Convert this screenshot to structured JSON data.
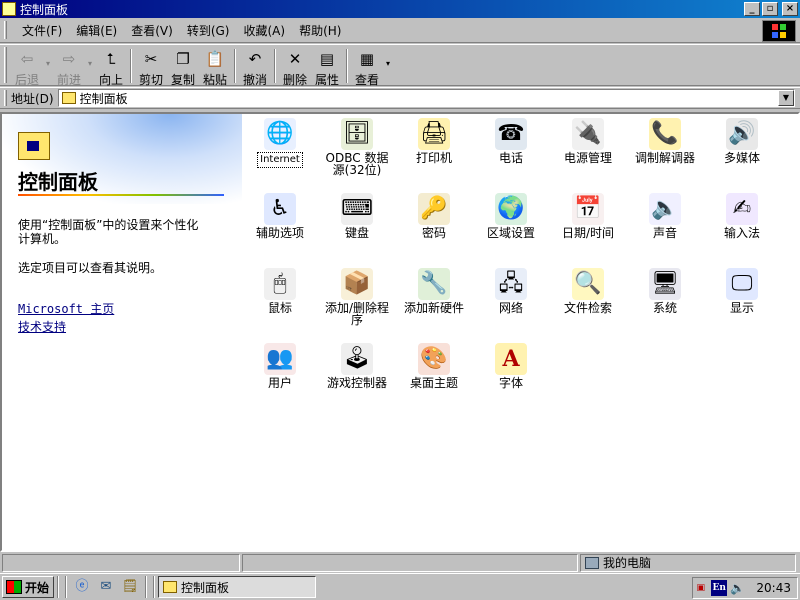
{
  "window": {
    "title": "控制面板",
    "min_symbol": "_",
    "max_symbol": "▫",
    "close_symbol": "×"
  },
  "menu": [
    "文件(F)",
    "编辑(E)",
    "查看(V)",
    "转到(G)",
    "收藏(A)",
    "帮助(H)"
  ],
  "toolbar": {
    "back": "后退",
    "forward": "前进",
    "up": "向上",
    "cut": "剪切",
    "copy": "复制",
    "paste": "粘贴",
    "undo": "撤消",
    "delete": "删除",
    "properties": "属性",
    "views": "查看",
    "dropdown_symbol": "▾"
  },
  "address": {
    "label": "地址(D)",
    "value": "控制面板",
    "drop_symbol": "▼"
  },
  "left_pane": {
    "title": "控制面板",
    "description": "使用“控制面板”中的设置来个性化计算机。",
    "hint": "选定项目可以查看其说明。",
    "link_home": "Microsoft 主页",
    "link_support": "技术支持"
  },
  "items": [
    {
      "label": "Internet",
      "icon": "internet-icon",
      "glyph": "🌐",
      "color": "#e8f0ff"
    },
    {
      "label": "ODBC 数据源(32位)",
      "icon": "database-icon",
      "glyph": "🗄",
      "color": "#e8f0d8"
    },
    {
      "label": "打印机",
      "icon": "printer-folder-icon",
      "glyph": "🖨",
      "color": "#fff2b0"
    },
    {
      "label": "电话",
      "icon": "phone-icon",
      "glyph": "☎",
      "color": "#e0e8f0"
    },
    {
      "label": "电源管理",
      "icon": "power-icon",
      "glyph": "🔌",
      "color": "#f0f0f0"
    },
    {
      "label": "调制解调器",
      "icon": "modem-icon",
      "glyph": "📞",
      "color": "#fff2b0"
    },
    {
      "label": "多媒体",
      "icon": "multimedia-icon",
      "glyph": "🔊",
      "color": "#e8e8e8"
    },
    {
      "label": "辅助选项",
      "icon": "accessibility-icon",
      "glyph": "♿",
      "color": "#dfe8ff"
    },
    {
      "label": "键盘",
      "icon": "keyboard-icon",
      "glyph": "⌨",
      "color": "#eeeeee"
    },
    {
      "label": "密码",
      "icon": "password-key-icon",
      "glyph": "🔑",
      "color": "#f4ecd0"
    },
    {
      "label": "区域设置",
      "icon": "globe-icon",
      "glyph": "🌍",
      "color": "#d8f0e0"
    },
    {
      "label": "日期/时间",
      "icon": "date-time-icon",
      "glyph": "📅",
      "color": "#f8f0f0"
    },
    {
      "label": "声音",
      "icon": "sound-icon",
      "glyph": "🔈",
      "color": "#f0f0ff"
    },
    {
      "label": "输入法",
      "icon": "input-method-icon",
      "glyph": "✍",
      "color": "#f0e8ff"
    },
    {
      "label": "鼠标",
      "icon": "mouse-icon",
      "glyph": "🖱",
      "color": "#f0f0f0"
    },
    {
      "label": "添加/删除程序",
      "icon": "add-remove-programs-icon",
      "glyph": "📦",
      "color": "#f8f0d8"
    },
    {
      "label": "添加新硬件",
      "icon": "add-hardware-icon",
      "glyph": "🔧",
      "color": "#e0f0d8"
    },
    {
      "label": "网络",
      "icon": "network-icon",
      "glyph": "🖧",
      "color": "#e8eef8"
    },
    {
      "label": "文件检索",
      "icon": "find-fast-icon",
      "glyph": "🔍",
      "color": "#fff8c0"
    },
    {
      "label": "系统",
      "icon": "system-computer-icon",
      "glyph": "🖥",
      "color": "#e8e8f0"
    },
    {
      "label": "显示",
      "icon": "display-icon",
      "glyph": "🖵",
      "color": "#e0e8ff"
    },
    {
      "label": "用户",
      "icon": "users-icon",
      "glyph": "👥",
      "color": "#f8e8e8"
    },
    {
      "label": "游戏控制器",
      "icon": "joystick-icon",
      "glyph": "🕹",
      "color": "#eeeeee"
    },
    {
      "label": "桌面主题",
      "icon": "desktop-themes-icon",
      "glyph": "🎨",
      "color": "#f8e0d8"
    },
    {
      "label": "字体",
      "icon": "fonts-folder-icon",
      "glyph": "A",
      "color": "#fff2b0"
    }
  ],
  "status": {
    "computer": "我的电脑"
  },
  "taskbar": {
    "start": "开始",
    "task": "控制面板",
    "tray_lang": "En",
    "clock": "20:43"
  }
}
